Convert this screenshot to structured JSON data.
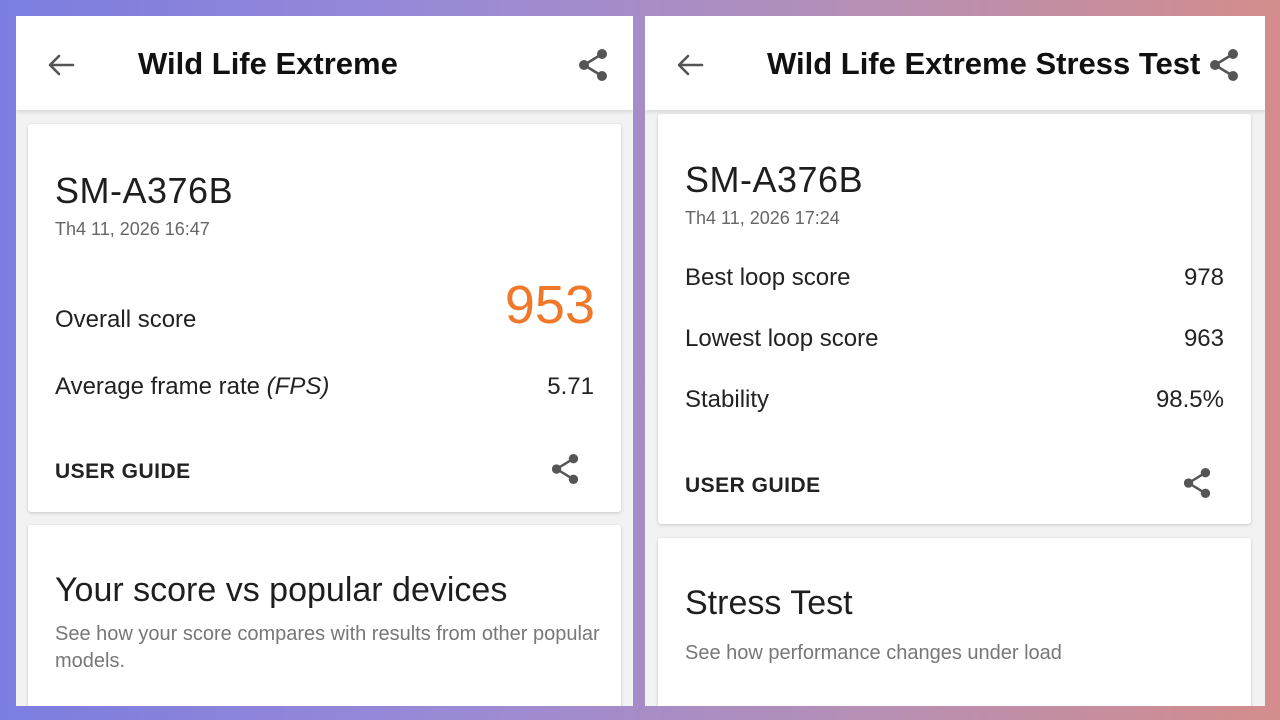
{
  "left": {
    "title": "Wild Life Extreme",
    "device": "SM-A376B",
    "date": "Th4 11, 2026 16:47",
    "overall_label": "Overall score",
    "overall_value": "953",
    "fps_label_prefix": "Average frame rate ",
    "fps_label_unit": "(FPS)",
    "fps_value": "5.71",
    "user_guide": "USER GUIDE",
    "compare_title": "Your score vs popular devices",
    "compare_desc": "See how your score compares with results from other popular models."
  },
  "right": {
    "title": "Wild Life Extreme Stress Test",
    "device": "SM-A376B",
    "date": "Th4 11, 2026 17:24",
    "rows": [
      {
        "label": "Best loop score",
        "value": "978"
      },
      {
        "label": "Lowest loop score",
        "value": "963"
      },
      {
        "label": "Stability",
        "value": "98.5%"
      }
    ],
    "user_guide": "USER GUIDE",
    "stress_title": "Stress Test",
    "stress_desc": "See how performance changes under load"
  },
  "icons": {
    "back": "arrow-left-icon",
    "share": "share-icon"
  },
  "colors": {
    "score_accent": "#f0782a",
    "background_gradient_start": "#7b7de0",
    "background_gradient_end": "#d48d8c"
  }
}
